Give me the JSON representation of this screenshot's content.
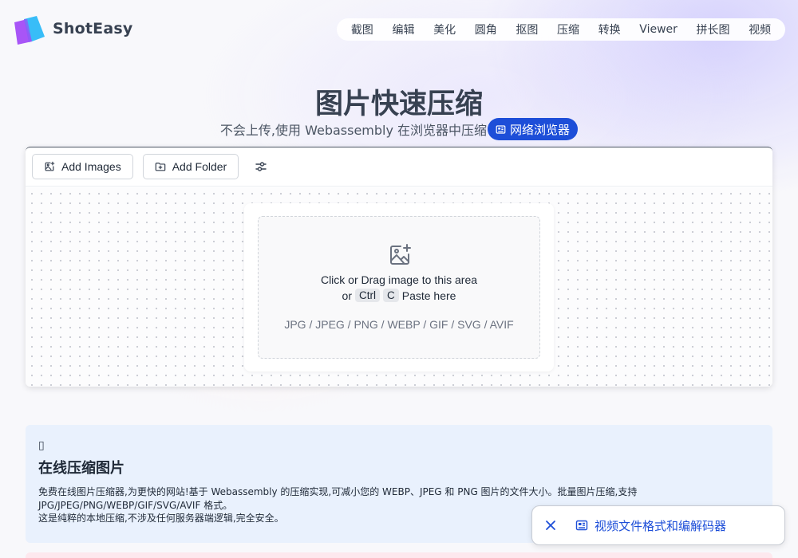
{
  "header": {
    "brand": "ShotEasy",
    "nav": [
      "截图",
      "编辑",
      "美化",
      "圆角",
      "抠图",
      "压缩",
      "转换",
      "Viewer",
      "拼长图",
      "视频"
    ]
  },
  "hero": {
    "title": "图片快速压缩",
    "subtitle": "不会上传,使用 Webassembly 在浏览器中压缩",
    "badge": "网络浏览器"
  },
  "toolbar": {
    "add_images": "Add Images",
    "add_folder": "Add Folder"
  },
  "dropzone": {
    "line1": "Click or Drag image to this area",
    "or": "or",
    "key1": "Ctrl",
    "key2": "C",
    "paste": "Paste here",
    "formats": "JPG / JPEG / PNG / WEBP / GIF / SVG / AVIF"
  },
  "info": {
    "emoji": "▯",
    "title": "在线压缩图片",
    "line1": "免费在线图片压缩器,为更快的网站!基于 Webassembly 的压缩实现,可减小您的 WEBP、JPEG 和 PNG 图片的文件大小。批量图片压缩,支持 JPG/JPEG/PNG/WEBP/GIF/SVG/AVIF 格式。",
    "line2": "这是纯粹的本地压缩,不涉及任何服务器端逻辑,完全安全。"
  },
  "toast": {
    "text": "视频文件格式和编解码器"
  },
  "colors": {
    "accent": "#1d4ed8",
    "info_bg": "#e9f1fd",
    "logo_purple": "#a855f7",
    "logo_blue": "#38bdf8"
  },
  "icons": [
    "logo",
    "image-plus-icon",
    "folder-plus-icon",
    "sliders-icon",
    "newspaper-icon",
    "close-icon"
  ]
}
